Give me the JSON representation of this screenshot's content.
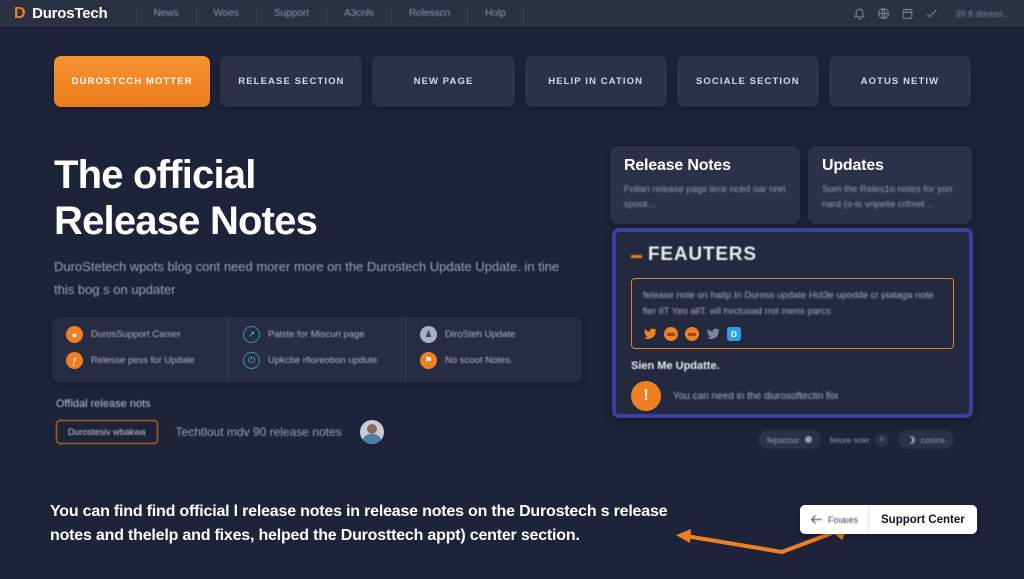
{
  "brand": {
    "mark": "D",
    "name": "DurosTech"
  },
  "topnav": {
    "items": [
      {
        "label": "News"
      },
      {
        "label": "Woes"
      },
      {
        "label": "Support"
      },
      {
        "label": "A3cnls"
      },
      {
        "label": "Rolesscn"
      },
      {
        "label": "Holp"
      }
    ],
    "icons": [
      "bell-icon",
      "globe-icon",
      "calendar-icon",
      "check-icon"
    ],
    "status_text": "39 8 dontsrl..."
  },
  "tabs": [
    {
      "label": "DUROSTCCH MOTTER",
      "active": true
    },
    {
      "label": "RELEASE SECTION",
      "active": false
    },
    {
      "label": "NEW PAGE",
      "active": false
    },
    {
      "label": "HELIP IN CATION",
      "active": false
    },
    {
      "label": "SOCIALE SECTION",
      "active": false
    },
    {
      "label": "AOTUS NETIW",
      "active": false
    }
  ],
  "hero": {
    "title_line1": "The official",
    "title_line2": "Release Notes",
    "subtitle": "DuroStetech wpots blog cont need morer more on the Durostech Update Update. in tine this bog s on updater"
  },
  "features_box": {
    "columns": [
      {
        "items": [
          {
            "icon": "user-circle-icon",
            "icon_style": "orange",
            "glyph": "●",
            "label": "DurosSupport Camer"
          },
          {
            "icon": "info-circle-icon",
            "icon_style": "orange",
            "glyph": "ƒ",
            "label": "Relesse pess for Updale"
          }
        ]
      },
      {
        "items": [
          {
            "icon": "clock-circle-icon",
            "icon_style": "teal",
            "glyph": "↗",
            "label": "Palste for Miscuri page"
          },
          {
            "icon": "power-circle-icon",
            "icon_style": "teal",
            "glyph": "⏻",
            "label": "Upkcbe rfioreobon updute"
          }
        ]
      },
      {
        "items": [
          {
            "icon": "person-circle-icon",
            "icon_style": "grey",
            "glyph": "♟",
            "label": "DiroSteh Update"
          },
          {
            "icon": "flag-circle-icon",
            "icon_style": "orange",
            "glyph": "⚑",
            "label": "No scoot Notes."
          }
        ]
      }
    ]
  },
  "official": {
    "label": "Offidal release nots",
    "button_label": "Durostesiv wbakwa",
    "text": "Techtlout mdv 90 release notes",
    "avatar": "user-avatar"
  },
  "right_cards": [
    {
      "title": "Release Notes",
      "body": "Follan release pags lece nced oar nret spoot..."
    },
    {
      "title": "Updates",
      "body": "Som the Reles1o notes for yon nard (o-ls vripetie crfmet .."
    }
  ],
  "features_panel": {
    "title": "FEAUTERS",
    "boxed_text": "felease note on haitp In Duress update Hol3e upodde cr piataga note fier lIT Yeo allT. wll hvctuoad rrot mens parcs",
    "social_icons": [
      "twitter-bird-orange-icon",
      "chat-circle-orange-icon",
      "chat-circle-orange-icon",
      "twitter-bird-grey-icon",
      "blue-square-icon"
    ],
    "sign_label": "Sien Me Updatte.",
    "alert_badge": "!",
    "alert_text": "You can need in the diurosoftectin fiix"
  },
  "pill_controls": [
    {
      "type": "pill",
      "label": "fepacisɑ",
      "icon": "dot-icon"
    },
    {
      "type": "flat",
      "label": "feture sokr",
      "chip": "s"
    },
    {
      "type": "pill",
      "label": "caxice",
      "icon": "moon-icon"
    }
  ],
  "bottom": {
    "text": "You can find find official l release notes in release notes on the Durostech s release notes and thelelp and fixes,  helped the Durosttech appt) center section.",
    "arrow": "orange-left-arrow",
    "back_label": "Foıaıes",
    "support_label": "Support Center"
  },
  "colors": {
    "background": "#1d2338",
    "accent_orange": "#ee7f20",
    "panel_blue": "#3a3f9c",
    "card": "#2b3248",
    "text_primary": "#ffffff",
    "text_muted": "#9aa2b8"
  }
}
